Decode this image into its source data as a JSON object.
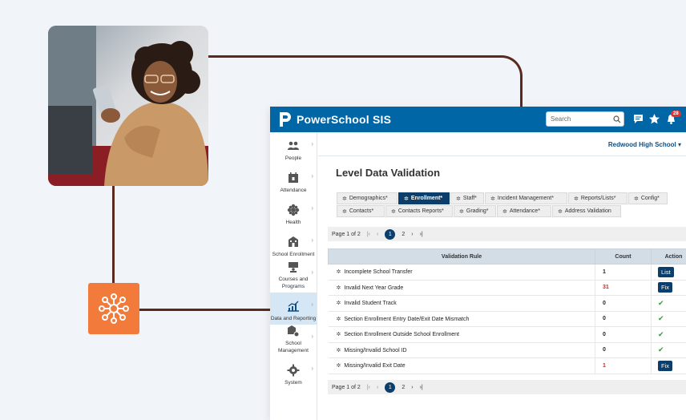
{
  "app": {
    "title": "PowerSchool SIS",
    "search_placeholder": "Search",
    "notification_count": "28",
    "school": "Redwood High School"
  },
  "colors": {
    "topbar": "#0066a6",
    "accent_dark": "#0b3e6b",
    "tile": "#f27a3a",
    "connector": "#5a2a1e"
  },
  "icons": {
    "tile": "network-hub-icon"
  },
  "sidebar": {
    "items": [
      {
        "label": "People",
        "icon": "people-icon"
      },
      {
        "label": "Attendance",
        "icon": "calendar-icon"
      },
      {
        "label": "Health",
        "icon": "health-icon"
      },
      {
        "label": "School Enrollment",
        "icon": "school-icon"
      },
      {
        "label": "Courses and Programs",
        "icon": "presenter-icon"
      },
      {
        "label": "Data and Reporting",
        "icon": "chart-icon",
        "active": true
      },
      {
        "label": "School Management",
        "icon": "school-gear-icon"
      },
      {
        "label": "System",
        "icon": "gear-icon"
      }
    ]
  },
  "page": {
    "title": "Level Data Validation"
  },
  "tabs": [
    {
      "label": "Demographics*"
    },
    {
      "label": "Enrollment*",
      "active": true
    },
    {
      "label": "Staff*"
    },
    {
      "label": "Incident Management*"
    },
    {
      "label": "Reports/Lists*"
    },
    {
      "label": "Config*"
    },
    {
      "label": "Contacts*"
    },
    {
      "label": "Contacts Reports*"
    },
    {
      "label": "Grading*"
    },
    {
      "label": "Attendance*"
    },
    {
      "label": "Address Validation"
    }
  ],
  "pager": {
    "label": "Page 1 of 2",
    "current": "1",
    "next": "2",
    "first": "|‹",
    "prev": "‹",
    "next_arrow": "›",
    "last": "›|"
  },
  "table": {
    "headers": [
      "Validation Rule",
      "Count",
      "Action"
    ],
    "rows": [
      {
        "rule": "Incomplete School Transfer",
        "count": "1",
        "action": "List"
      },
      {
        "rule": "Invalid Next Year Grade",
        "count": "31",
        "action": "Fix",
        "count_red": true
      },
      {
        "rule": "Invalid Student Track",
        "count": "0",
        "action": "check"
      },
      {
        "rule": "Section Enrollment Entry Date/Exit Date Mismatch",
        "count": "0",
        "action": "check"
      },
      {
        "rule": "Section Enrollment Outside School Enrollment",
        "count": "0",
        "action": "check"
      },
      {
        "rule": "Missing/Invalid School ID",
        "count": "0",
        "action": "check"
      },
      {
        "rule": "Missing/Invalid Exit Date",
        "count": "1",
        "action": "Fix",
        "count_red": true
      }
    ]
  }
}
